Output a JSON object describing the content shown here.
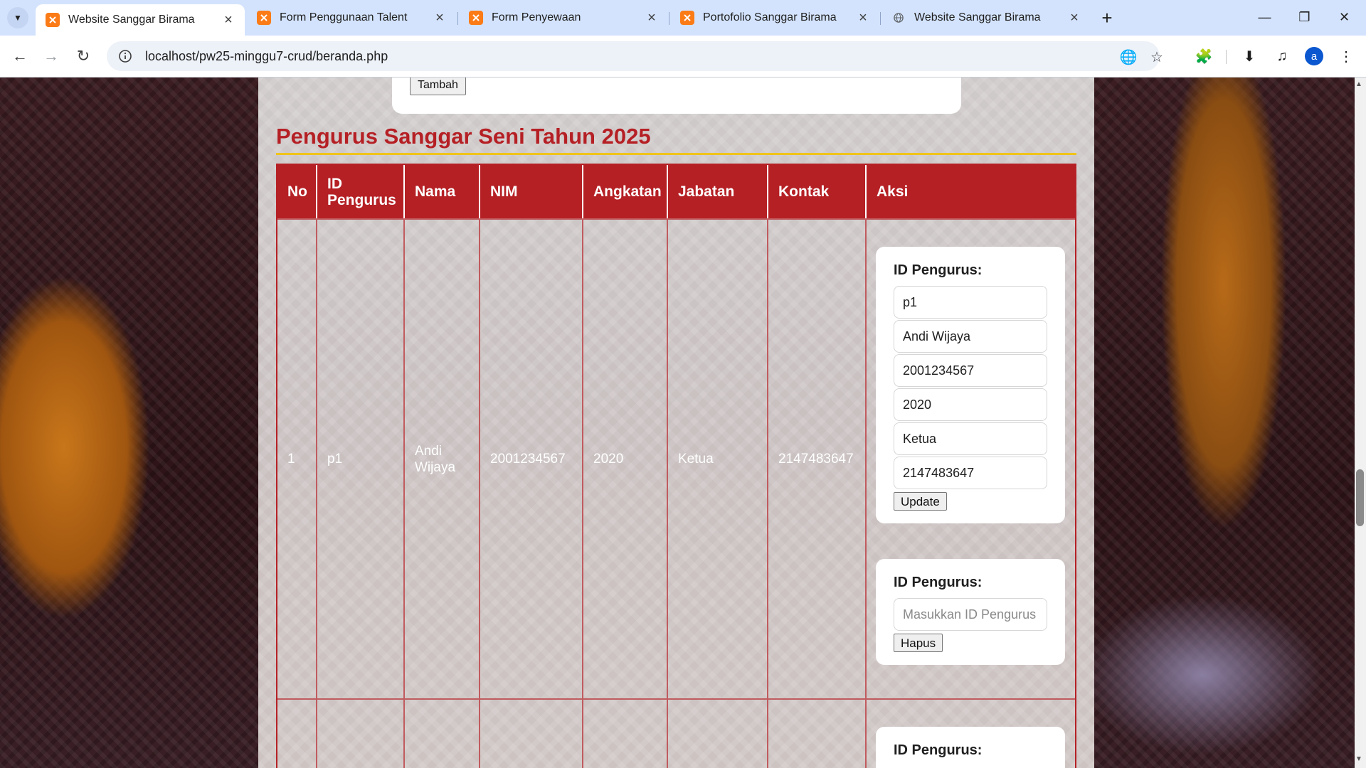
{
  "browser": {
    "tabs": [
      {
        "title": "Website Sanggar Birama",
        "icon": "xampp-icon",
        "active": true
      },
      {
        "title": "Form Penggunaan Talent",
        "icon": "xampp-icon",
        "active": false
      },
      {
        "title": "Form Penyewaan",
        "icon": "xampp-icon",
        "active": false
      },
      {
        "title": "Portofolio Sanggar Birama",
        "icon": "xampp-icon",
        "active": false
      },
      {
        "title": "Website Sanggar Birama",
        "icon": "globe-icon",
        "active": false
      }
    ],
    "url": "localhost/pw25-minggu7-crud/beranda.php",
    "profile_initial": "a"
  },
  "page": {
    "add_button": "Tambah",
    "section_title": "Pengurus Sanggar Seni Tahun 2025",
    "table": {
      "headers": [
        "No",
        "ID Pengurus",
        "Nama",
        "NIM",
        "Angkatan",
        "Jabatan",
        "Kontak",
        "Aksi"
      ],
      "rows": [
        {
          "no": "1",
          "id": "p1",
          "nama": "Andi Wijaya",
          "nim": "2001234567",
          "angkatan": "2020",
          "jabatan": "Ketua",
          "kontak": "2147483647"
        }
      ]
    },
    "update_form": {
      "label": "ID Pengurus:",
      "values": [
        "p1",
        "Andi Wijaya",
        "2001234567",
        "2020",
        "Ketua",
        "2147483647"
      ],
      "button": "Update"
    },
    "delete_form": {
      "label": "ID Pengurus:",
      "placeholder": "Masukkan ID Pengurus",
      "button": "Hapus"
    },
    "next_form": {
      "label": "ID Pengurus:"
    }
  },
  "colors": {
    "accent": "#b52025",
    "rule": "#f0c419",
    "favicon": "#fb7b17"
  }
}
